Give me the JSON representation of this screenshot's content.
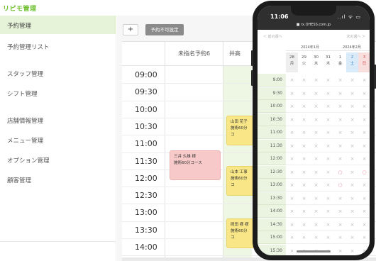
{
  "app": {
    "brand": "リピモ管理"
  },
  "sidebar": {
    "items": [
      {
        "label": "予約管理",
        "active": true
      },
      {
        "label": "予約管理リスト"
      },
      {
        "label": "スタッフ管理"
      },
      {
        "label": "シフト管理"
      },
      {
        "label": "店舗情報管理"
      },
      {
        "label": "メニュー管理"
      },
      {
        "label": "オプション管理"
      },
      {
        "label": "顧客管理"
      }
    ]
  },
  "toolbar": {
    "add_label": "+",
    "block_label": "予約不可設定"
  },
  "schedule": {
    "columns": [
      "未指名予約6",
      "井高"
    ],
    "times": [
      "09:00",
      "09:30",
      "10:00",
      "10:30",
      "11:00",
      "11:30",
      "12:00",
      "12:30",
      "13:00",
      "13:30",
      "14:00"
    ],
    "appointments": [
      {
        "name": "三井 久雄 様",
        "course": "施術60分コース",
        "color": "pink"
      },
      {
        "name": "山田 花子",
        "course": "施術60分コ",
        "color": "yellow"
      },
      {
        "name": "山本 工事",
        "course": "施術60分コ",
        "color": "yellow"
      },
      {
        "name": "岡田 様 様",
        "course": "施術60分コ",
        "color": "yellow"
      }
    ]
  },
  "phone": {
    "clock": "11:06",
    "signal": "..ıl ᯤ ▭",
    "url": "■ rx.OHESS.com.jp",
    "prev": "＜ 前の週へ",
    "next": "次の週へ ＞",
    "months": [
      "2024年1月",
      "2024年2月"
    ],
    "days": [
      {
        "num": "28",
        "dow": "月"
      },
      {
        "num": "29",
        "dow": "火"
      },
      {
        "num": "30",
        "dow": "水"
      },
      {
        "num": "31",
        "dow": "木"
      },
      {
        "num": "1",
        "dow": "金"
      },
      {
        "num": "2",
        "dow": "土"
      },
      {
        "num": "3",
        "dow": "日"
      }
    ],
    "times": [
      "9:00",
      "9:30",
      "10:00",
      "10:30",
      "11:00",
      "11:30",
      "12:00",
      "12:30",
      "13:00",
      "13:30",
      "14:00",
      "14:30",
      "15:00",
      "15:30"
    ],
    "unavailable_symbol": "×",
    "available_symbol": "○",
    "available_slots": [
      [
        7,
        4
      ],
      [
        8,
        4
      ],
      [
        7,
        6
      ]
    ],
    "colors": {
      "accent": "#6bbf2a",
      "available": "#e88fa1"
    }
  }
}
